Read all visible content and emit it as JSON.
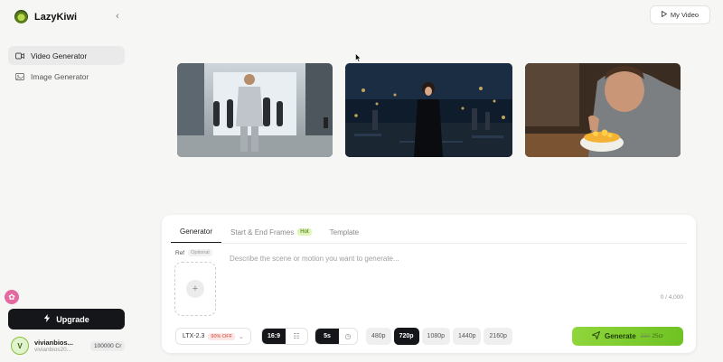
{
  "app": {
    "name": "LazyKiwi"
  },
  "sidebar": {
    "items": [
      {
        "label": "Video Generator",
        "active": true,
        "icon": "video-icon"
      },
      {
        "label": "Image Generator",
        "active": false,
        "icon": "image-icon"
      }
    ],
    "upgrade_label": "Upgrade",
    "user": {
      "initial": "V",
      "name": "vivianbios...",
      "email": "vivianbios20...",
      "credits": "100000 Cr"
    }
  },
  "header": {
    "my_video_label": "My Video"
  },
  "composer": {
    "tabs": [
      {
        "label": "Generator",
        "active": true
      },
      {
        "label": "Start & End Frames",
        "badge": "Hot",
        "active": false
      },
      {
        "label": "Template",
        "active": false
      }
    ],
    "ref_label": "Ref",
    "ref_optional": "Optional",
    "prompt_placeholder": "Describe the scene or motion you want to generate...",
    "char_count": "0 / 4,000",
    "model": {
      "label": "LTX-2.3",
      "discount": "90% OFF"
    },
    "aspect_ratio": "16:9",
    "duration": "5s",
    "resolutions": [
      "480p",
      "720p",
      "1080p",
      "1440p",
      "2160p"
    ],
    "selected_resolution": "720p",
    "generate": {
      "label": "Generate",
      "old_cost": "250",
      "cost": "25cr"
    }
  },
  "colors": {
    "accent": "#7cc92f",
    "dark": "#15161a",
    "background": "#f6f6f5"
  }
}
